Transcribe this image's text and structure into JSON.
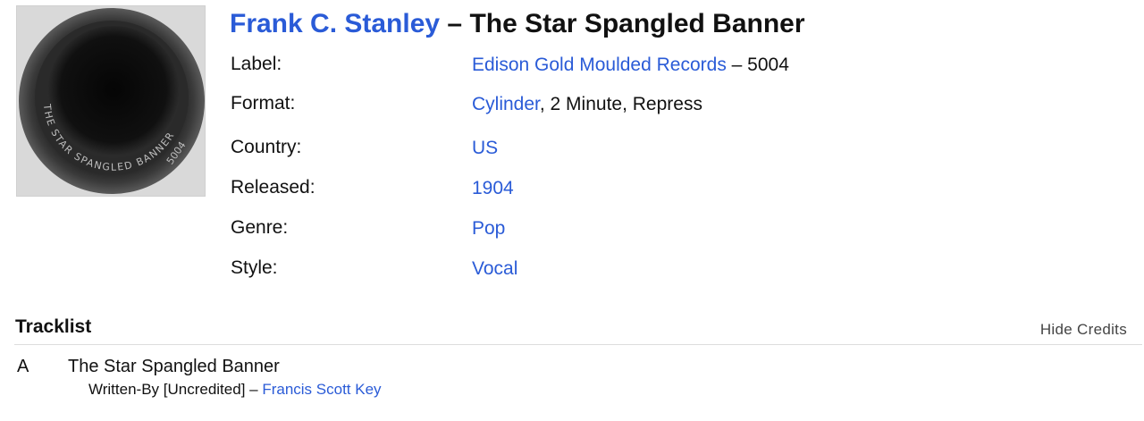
{
  "release": {
    "artist": "Frank C. Stanley",
    "separator": "–",
    "title": "The Star Spangled Banner"
  },
  "thumbnail": {
    "ring_text": "THE STAR SPANGLED BANNER",
    "catalog_text": "5004"
  },
  "info": {
    "label": {
      "label": "Label:",
      "link": "Edison Gold Moulded Records",
      "suffix": " – 5004"
    },
    "format": {
      "label": "Format:",
      "link": "Cylinder",
      "suffix": ", 2 Minute, Repress"
    },
    "country": {
      "label": "Country:",
      "link": "US"
    },
    "released": {
      "label": "Released:",
      "link": "1904"
    },
    "genre": {
      "label": "Genre:",
      "link": "Pop"
    },
    "style": {
      "label": "Style:",
      "link": "Vocal"
    }
  },
  "tracklist": {
    "heading": "Tracklist",
    "toggle_label": "Hide Credits",
    "tracks": [
      {
        "position": "A",
        "title": "The Star Spangled Banner",
        "credit_role": "Written-By [Uncredited] – ",
        "credit_name": "Francis Scott Key"
      }
    ]
  },
  "colors": {
    "link": "#2a5bd7",
    "text": "#111111",
    "divider": "#dddddd"
  }
}
